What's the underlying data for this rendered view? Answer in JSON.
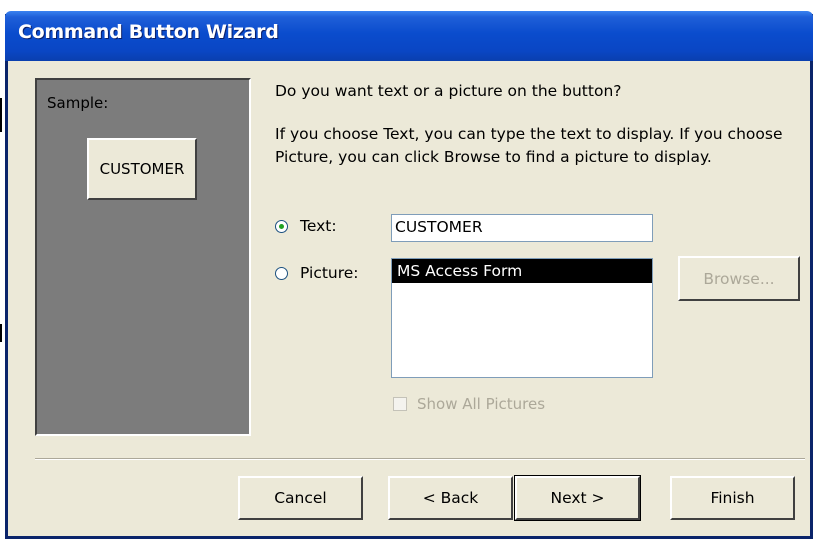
{
  "window": {
    "title": "Command Button Wizard"
  },
  "sample": {
    "label": "Sample:",
    "button_text": "CUSTOMER"
  },
  "main": {
    "question": "Do you want text or a picture on the button?",
    "instruction": "If you choose Text, you can type the text to display.  If you choose Picture, you can click Browse to find a picture to display.",
    "text_option": {
      "label": "Text:",
      "checked": true,
      "value": "CUSTOMER"
    },
    "picture_option": {
      "label": "Picture:",
      "checked": false,
      "items": [
        "MS Access Form"
      ],
      "selected_item": "MS Access Form"
    },
    "browse_button": {
      "label": "Browse..."
    },
    "show_all_pictures": {
      "label": "Show All Pictures",
      "checked": false,
      "disabled": true
    }
  },
  "footer": {
    "cancel_label": "Cancel",
    "back_label": "< Back",
    "next_label": "Next >",
    "finish_label": "Finish"
  },
  "colors": {
    "title_bar": "#0a46c4",
    "dialog_bg": "#ece9d8",
    "sample_panel_bg": "#7c7c7c",
    "selection_bg": "#000000",
    "disabled_text": "#aca899"
  }
}
